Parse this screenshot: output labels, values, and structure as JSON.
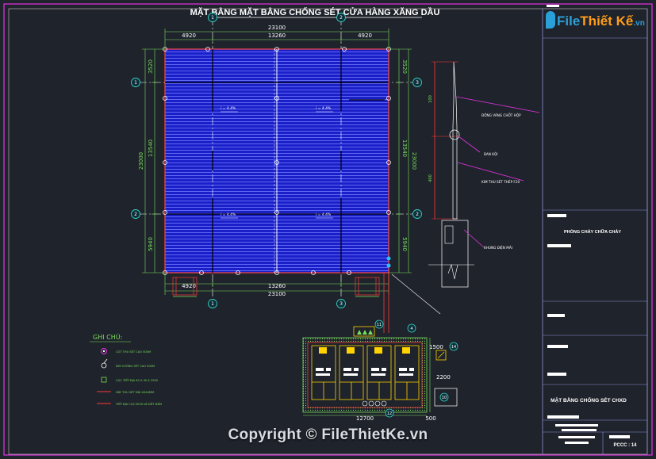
{
  "title": "MẶT BẰNG MẶT BẰNG CHỐNG SÉT CỬA HÀNG XĂNG DẦU",
  "logo": {
    "main": "File",
    "accent": "Thiết Kế",
    "suffix": ".vn"
  },
  "watermark": "Copyright © FileThietKe.vn",
  "dims": {
    "top_total": "23100",
    "top_left": "4920",
    "top_mid": "13260",
    "top_right": "4920",
    "left_total": "23000",
    "left_top": "3520",
    "left_mid": "13540",
    "left_bot": "5940",
    "right_total": "23000",
    "right_top": "3520",
    "right_mid": "13540",
    "right_bot": "5940",
    "bottom_mid": "13260",
    "bottom_total": "23100",
    "bottom_left": "4920",
    "rod_upper": "100",
    "rod_lower": "400",
    "pit_width": "12700",
    "pit_right": "500",
    "pit_offset": "1500",
    "pit_height": "2200"
  },
  "slopes": {
    "s1": "i = 4.4%",
    "s2": "i = 4.4%",
    "s3": "i = 4.4%",
    "s4": "i = 4.4%"
  },
  "grid": {
    "a1": "1",
    "a2": "2",
    "a3": "3",
    "b1": "1",
    "b2": "2",
    "b3": "3"
  },
  "detail_labels": {
    "tip": "ĐỒNG VÀNG CHỐT HỘP",
    "ball": "BAN KỘI",
    "rod": "KIM THU SÉT THÉP F20",
    "base": "KHUNG ĐIỆN MÁI"
  },
  "legend": {
    "title": "GHI CHÚ:",
    "items": [
      "CỘT THU SÉT CAO 500M",
      "KIM CHỐNG SÉT CAO 500M",
      "CỌC TIẾP ĐỊA 40 X 40 X 2500",
      "DÂY THU SÉT MÁI 40X4MM",
      "TIẾP ĐỊA CỌC ĐƠN VÀ ĐẤT ĐẤM"
    ]
  },
  "title_block": {
    "department": "PHÒNG CHÁY CHỮA CHÁY",
    "drawing_title": "MẶT BẰNG CHỐNG SÉT CHXD",
    "sheet": "PCCC : 14"
  },
  "pit_tags": {
    "p1": "11",
    "p2": "4",
    "p3": "12",
    "p4": "14",
    "p5": "10"
  }
}
